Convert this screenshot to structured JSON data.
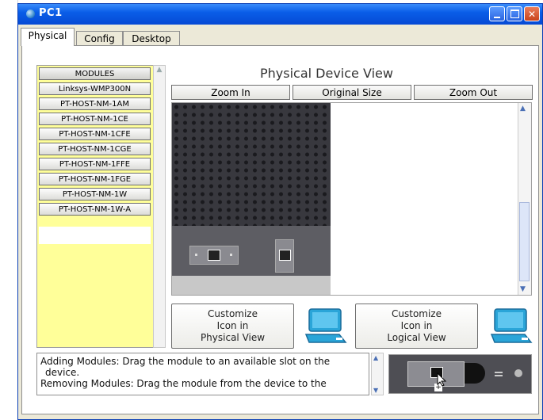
{
  "window": {
    "title": "PC1"
  },
  "tabs": [
    {
      "label": "Physical",
      "active": true
    },
    {
      "label": "Config",
      "active": false
    },
    {
      "label": "Desktop",
      "active": false
    }
  ],
  "modules": {
    "header": "MODULES",
    "items": [
      "Linksys-WMP300N",
      "PT-HOST-NM-1AM",
      "PT-HOST-NM-1CE",
      "PT-HOST-NM-1CFE",
      "PT-HOST-NM-1CGE",
      "PT-HOST-NM-1FFE",
      "PT-HOST-NM-1FGE",
      "PT-HOST-NM-1W",
      "PT-HOST-NM-1W-A"
    ]
  },
  "device_view": {
    "title": "Physical Device View",
    "zoom_in": "Zoom In",
    "original_size": "Original Size",
    "zoom_out": "Zoom Out"
  },
  "customize": {
    "physical": [
      "Customize",
      "Icon in",
      "Physical View"
    ],
    "logical": [
      "Customize",
      "Icon in",
      "Logical View"
    ]
  },
  "status": {
    "line1": "Adding Modules: Drag the module to an available slot on the",
    "line2": "device.",
    "line3": "Removing Modules: Drag the module from the device to the"
  },
  "colors": {
    "module_list_bg": "#ffff99",
    "titlebar": "#0a5ee8"
  }
}
